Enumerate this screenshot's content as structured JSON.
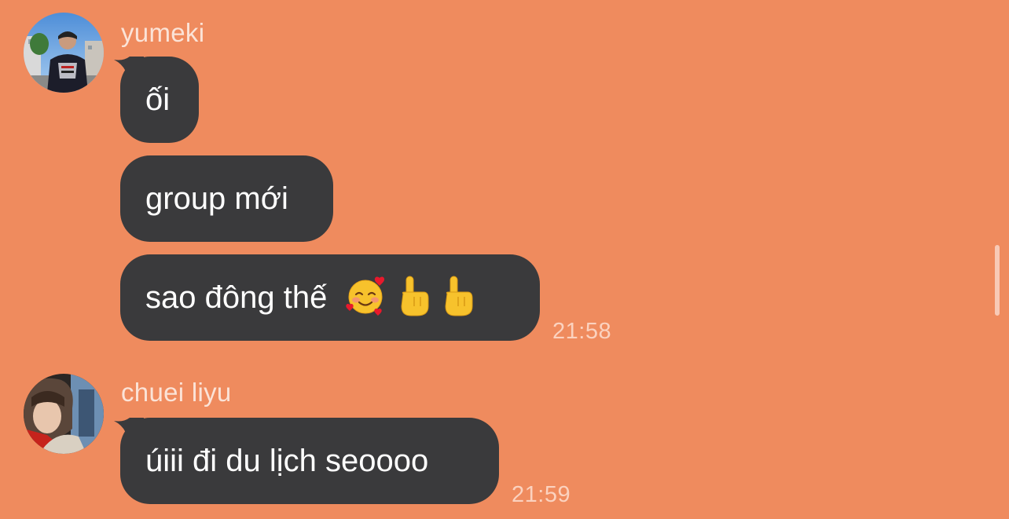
{
  "messages": [
    {
      "sender": "yumeki",
      "avatar_icon": "user-avatar-photo",
      "bubbles": [
        "ối",
        "group mới",
        "sao đông thế"
      ],
      "emojis": [
        "smiling-face-with-hearts",
        "pointing-up-finger",
        "pointing-up-finger"
      ],
      "time": "21:58"
    },
    {
      "sender": "chuei liyu",
      "avatar_icon": "user-avatar-photo",
      "bubbles": [
        "úiii đi du lịch seoooo"
      ],
      "time": "21:59"
    }
  ],
  "colors": {
    "background": "#ef8b5e",
    "bubble": "#3a3a3c",
    "bubble_text": "#ffffff",
    "sender_text": "#fbe3d7",
    "time_text": "#fbd2bf"
  }
}
